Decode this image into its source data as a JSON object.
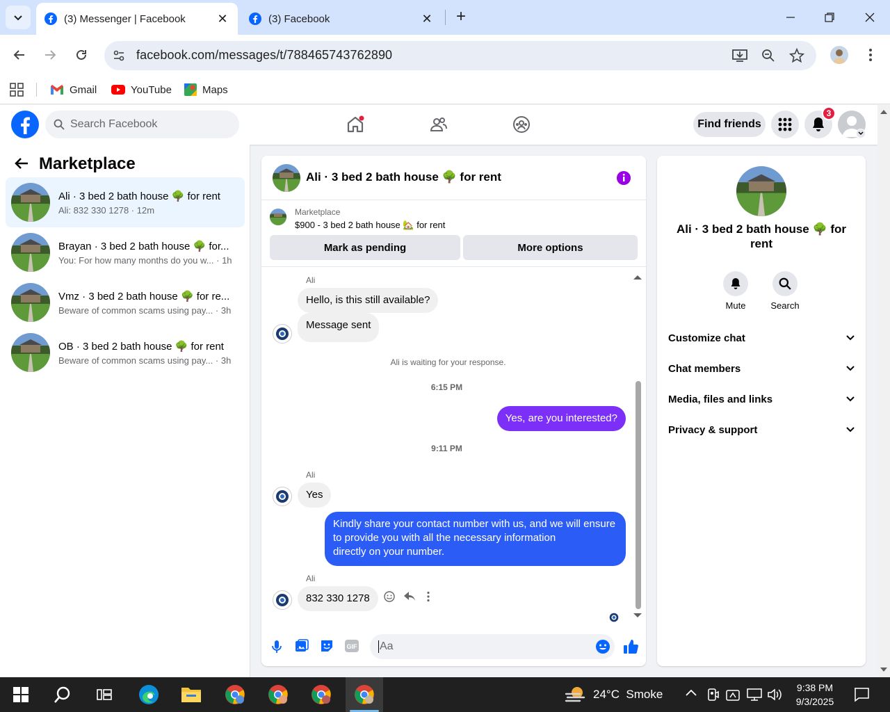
{
  "browser": {
    "tabs": [
      {
        "title": "(3) Messenger | Facebook",
        "active": true
      },
      {
        "title": "(3) Facebook",
        "active": false
      }
    ],
    "new_tab": "+",
    "url": "facebook.com/messages/t/788465743762890",
    "bookmarks": [
      {
        "label": "Gmail",
        "icon": "gmail-icon"
      },
      {
        "label": "YouTube",
        "icon": "youtube-icon"
      },
      {
        "label": "Maps",
        "icon": "maps-icon"
      }
    ]
  },
  "fb_header": {
    "search_placeholder": "Search Facebook",
    "find_friends": "Find friends",
    "notification_count": "3",
    "brand_color": "#0866ff"
  },
  "left_panel": {
    "title": "Marketplace",
    "conversations": [
      {
        "name": "Ali · 3 bed 2 bath house 🌳 for rent",
        "preview": "Ali: 832 330 1278 · 12m",
        "selected": true
      },
      {
        "name": "Brayan · 3 bed 2 bath house 🌳 for...",
        "preview": "You: For how many months do you w... · 1h",
        "selected": false
      },
      {
        "name": "Vmz · 3 bed 2 bath house 🌳 for re...",
        "preview": "Beware of common scams using pay... · 3h",
        "selected": false
      },
      {
        "name": "OB · 3 bed 2 bath house 🌳 for rent",
        "preview": "Beware of common scams using pay... · 3h",
        "selected": false
      }
    ]
  },
  "chat": {
    "title": "Ali · 3 bed 2 bath house 🌳 for rent",
    "marketplace_label": "Marketplace",
    "listing": "$900 - 3 bed 2 bath house 🏡 for rent",
    "mark_pending": "Mark as pending",
    "more_options": "More options",
    "messages": {
      "sender1": "Ali",
      "m1": "Hello, is this still available?",
      "m2": "Message sent",
      "waiting": "Ali is waiting for your response.",
      "time1": "6:15 PM",
      "m3": "Yes, are you interested?",
      "time2": "9:11 PM",
      "sender2": "Ali",
      "m4": "Yes",
      "m5_l1": "Kindly share your contact number with us, and we will ensure",
      "m5_l2": "to provide you with all the necessary information",
      "m5_l3": "directly on your number.",
      "sender3": "Ali",
      "m6": "832 330 1278"
    },
    "composer_placeholder": "Aa",
    "out_color_1": "#7b2ff7",
    "out_color_2": "#2b5cf6"
  },
  "right_panel": {
    "title": "Ali · 3 bed 2 bath house 🌳 for rent",
    "actions": [
      {
        "label": "Mute"
      },
      {
        "label": "Search"
      }
    ],
    "sections": [
      "Customize chat",
      "Chat members",
      "Media, files and links",
      "Privacy & support"
    ]
  },
  "taskbar": {
    "weather": "24°C  Smoke",
    "time": "9:38 PM",
    "date": "9/3/2025"
  }
}
